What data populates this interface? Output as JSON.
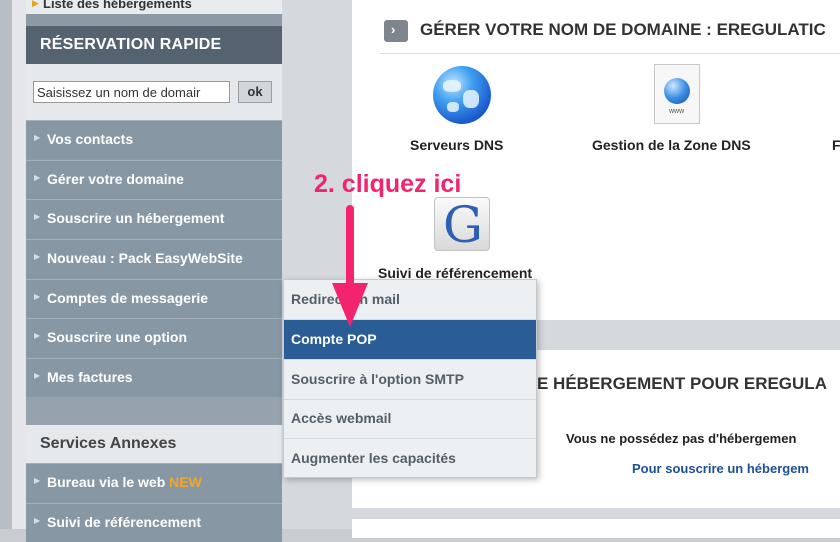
{
  "sidebar": {
    "top_link": "Liste des hébergements",
    "resa_title": "RÉSERVATION RAPIDE",
    "domain_input": {
      "value": "Saisissez un nom de domair",
      "ok_label": "ok"
    },
    "menu": [
      "Vos contacts",
      "Gérer votre domaine",
      "Souscrire un hébergement",
      "Nouveau : Pack EasyWebSite",
      "Comptes de messagerie",
      "Souscrire une option",
      "Mes factures"
    ],
    "annexes_title": "Services Annexes",
    "annexes_menu": [
      {
        "label": "Bureau via le web",
        "badge": "NEW"
      },
      {
        "label": "Suivi de référencement"
      }
    ]
  },
  "main": {
    "domain_panel_title": "GÉRER VOTRE NOM DE DOMAINE : EREGULATIC",
    "title_icon": "chevron-right-icon",
    "tools": [
      {
        "label": "Serveurs DNS",
        "icon": "globe-icon"
      },
      {
        "label": "Gestion de la Zone DNS",
        "icon": "dns-document-icon"
      },
      {
        "label": "F",
        "icon": ""
      },
      {
        "label": "Suivi de référencement",
        "icon": "google-g-icon"
      }
    ],
    "hosting_panel_title": "E HÉBERGEMENT POUR EREGULA",
    "hosting_text": "Vous ne possédez pas d'hébergemen",
    "hosting_link": "Pour souscrire un hébergem"
  },
  "dropdown": {
    "items": [
      "Redirection mail",
      "Compte POP",
      "Souscrire à l'option SMTP",
      "Accès webmail",
      "Augmenter les capacités"
    ],
    "active_index": 1
  },
  "annotation": {
    "text": "2. cliquez ici",
    "color": "#f4236d"
  }
}
